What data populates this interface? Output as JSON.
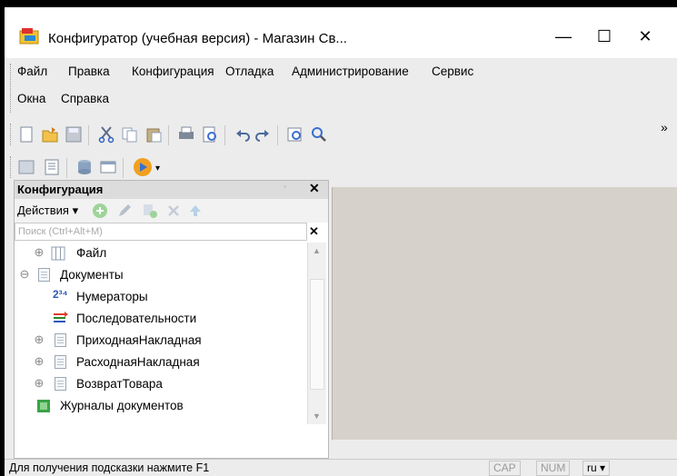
{
  "window": {
    "title": "Конфигуратор (учебная версия) - Магазин Св...",
    "minimize": "—",
    "maximize": "☐",
    "close": "✕"
  },
  "menu": {
    "items": [
      {
        "label": "Файл"
      },
      {
        "label": "Правка"
      },
      {
        "label": "Конфигурация"
      },
      {
        "label": "Отладка"
      },
      {
        "label": "Администрирование"
      },
      {
        "label": "Сервис"
      },
      {
        "label": "Окна"
      },
      {
        "label": "Справка"
      }
    ],
    "overflow": "»"
  },
  "panel": {
    "title": "Конфигурация",
    "pin": "▫",
    "close": "✕",
    "actions_label": "Действия ▾",
    "search_placeholder": "Поиск (Ctrl+Alt+M)",
    "search_clear": "✕",
    "tree": [
      {
        "label": "Файл",
        "icon": "table-icon",
        "expander": "⊕"
      },
      {
        "label": "Документы",
        "icon": "document-icon",
        "expander": "⊖"
      },
      {
        "label": "Нумераторы",
        "icon": "numerator-icon",
        "expander": ""
      },
      {
        "label": "Последовательности",
        "icon": "sequence-icon",
        "expander": ""
      },
      {
        "label": "ПриходнаяНакладная",
        "icon": "document-icon",
        "expander": "⊕"
      },
      {
        "label": "РасходнаяНакладная",
        "icon": "document-icon",
        "expander": "⊕"
      },
      {
        "label": "ВозвратТовара",
        "icon": "document-icon",
        "expander": "⊕"
      },
      {
        "label": "Журналы документов",
        "icon": "journal-icon",
        "expander": ""
      }
    ]
  },
  "status": {
    "hint": "Для получения подсказки нажмите F1",
    "cap": "CAP",
    "num": "NUM",
    "lang": "ru ▾"
  },
  "colors": {
    "frame": "#ececec",
    "workspace": "#d6d2cb",
    "accent_orange": "#f0a020"
  }
}
